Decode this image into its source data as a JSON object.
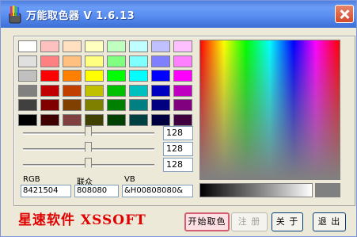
{
  "window": {
    "title": "万能取色器 V 1.6.13"
  },
  "swatches": [
    [
      "#ffffff",
      "#ffc0c0",
      "#ffe0c0",
      "#ffffc0",
      "#c0ffc0",
      "#c0ffff",
      "#c0c0ff",
      "#ffc0ff"
    ],
    [
      "#e0e0e0",
      "#ff8080",
      "#ffc080",
      "#ffff80",
      "#80ff80",
      "#80ffff",
      "#8080ff",
      "#ff80ff"
    ],
    [
      "#c0c0c0",
      "#ff0000",
      "#ff8000",
      "#ffff00",
      "#00ff00",
      "#00ffff",
      "#0000ff",
      "#ff00ff"
    ],
    [
      "#808080",
      "#c00000",
      "#c04000",
      "#c0c000",
      "#00c000",
      "#00c0c0",
      "#0000c0",
      "#c000c0"
    ],
    [
      "#404040",
      "#800000",
      "#804000",
      "#808000",
      "#008000",
      "#008080",
      "#000080",
      "#800080"
    ],
    [
      "#000000",
      "#400000",
      "#804040",
      "#404000",
      "#004000",
      "#004040",
      "#000040",
      "#400040"
    ]
  ],
  "sliders": [
    {
      "channel": "red",
      "value": "128"
    },
    {
      "channel": "green",
      "value": "128"
    },
    {
      "channel": "blue",
      "value": "128"
    }
  ],
  "fields": {
    "rgb_label": "RGB",
    "rgb_value": "8421504",
    "web_label": "联众",
    "web_value": "808080",
    "vb_label": "VB",
    "vb_value": "&H00808080&"
  },
  "preview_color": "#808080",
  "brand": "星速软件 XSSOFT",
  "buttons": {
    "pick": "开始取色",
    "register": "注 册",
    "about": "关 于",
    "exit": "退 出"
  }
}
